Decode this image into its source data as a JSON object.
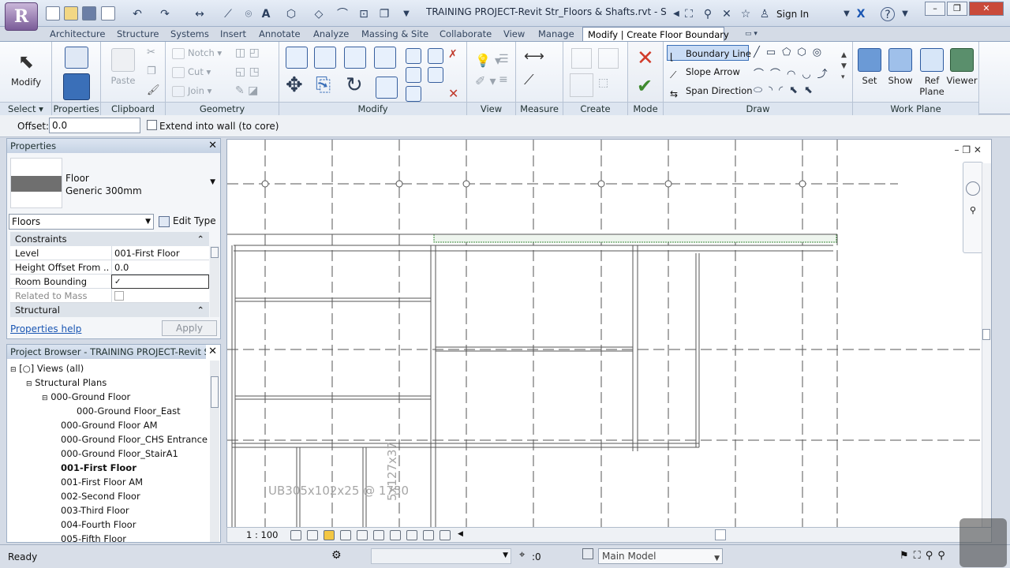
{
  "app": {
    "logo": "R",
    "title": "TRAINING PROJECT-Revit Str_Floors & Shafts.rvt - Struct...",
    "signin": "Sign In"
  },
  "tabs": [
    "Architecture",
    "Structure",
    "Systems",
    "Insert",
    "Annotate",
    "Analyze",
    "Massing & Site",
    "Collaborate",
    "View",
    "Manage",
    "Modify | Create Floor Boundary"
  ],
  "ribbon": {
    "select": {
      "button": "Modify",
      "panel": "Select"
    },
    "properties": {
      "panel": "Properties",
      "button": "Properties"
    },
    "clipboard": {
      "panel": "Clipboard",
      "paste": "Paste"
    },
    "geometry": {
      "panel": "Geometry",
      "notch": "Notch",
      "cut": "Cut",
      "join": "Join"
    },
    "modify": {
      "panel": "Modify"
    },
    "view": {
      "panel": "View"
    },
    "measure": {
      "panel": "Measure"
    },
    "create": {
      "panel": "Create"
    },
    "mode": {
      "panel": "Mode"
    },
    "draw": {
      "panel": "Draw",
      "boundary_line": "Boundary Line",
      "slope_arrow": "Slope Arrow",
      "span_direction": "Span Direction"
    },
    "workplane": {
      "panel": "Work Plane",
      "set": "Set",
      "show": "Show",
      "ref": "Ref",
      "plane": "Plane",
      "viewer": "Viewer"
    }
  },
  "optbar": {
    "offset_label": "Offset:",
    "offset_value": "0.0",
    "extend_label": "Extend into wall (to core)"
  },
  "properties": {
    "title": "Properties",
    "type_family": "Floor",
    "type_name": "Generic 300mm",
    "filter": "Floors",
    "edit_type": "Edit Type",
    "sections": {
      "constraints": "Constraints",
      "structural": "Structural"
    },
    "rows": [
      {
        "key": "Level",
        "value": "001-First Floor"
      },
      {
        "key": "Height Offset From ...",
        "value": "0.0"
      },
      {
        "key": "Room Bounding",
        "value": "✓"
      },
      {
        "key": "Related to Mass",
        "value": ""
      }
    ],
    "help": "Properties help",
    "apply": "Apply"
  },
  "browser": {
    "title": "Project Browser - TRAINING PROJECT-Revit Str_...",
    "items": [
      "Views (all)",
      "Structural Plans",
      "000-Ground Floor",
      "000-Ground Floor_East",
      "000-Ground Floor AM",
      "000-Ground Floor_CHS Entrance",
      "000-Ground Floor_StairA1",
      "001-First Floor",
      "001-First Floor AM",
      "002-Second Floor",
      "003-Third Floor",
      "004-Fourth Floor",
      "005-Fifth Floor"
    ]
  },
  "canvas": {
    "beam_label_1": "UB305x102x25 @ 1750",
    "beam_label_2": "5x127x37",
    "scale": "1 : 100"
  },
  "status": {
    "text": "Ready",
    "filter_count": ":0",
    "model": "Main Model"
  }
}
